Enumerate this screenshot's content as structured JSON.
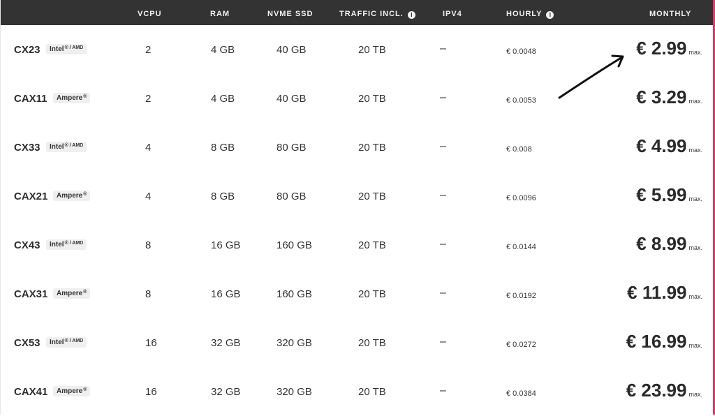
{
  "header": {
    "columns": [
      "VCPU",
      "RAM",
      "NVME SSD",
      "TRAFFIC INCL.",
      "IPV4",
      "HOURLY",
      "MONTHLY"
    ],
    "info_icon": "i"
  },
  "rows": [
    {
      "name": "CX23",
      "cpu": "Intel",
      "cpu_suffix": "® / AMD",
      "vcpu": "2",
      "ram": "4 GB",
      "ssd": "40 GB",
      "traffic": "20 TB",
      "ipv4": "–",
      "hourly": "€ 0.0048",
      "monthly": "€ 2.99",
      "max": "max."
    },
    {
      "name": "CAX11",
      "cpu": "Ampere",
      "cpu_suffix": "®",
      "vcpu": "2",
      "ram": "4 GB",
      "ssd": "40 GB",
      "traffic": "20 TB",
      "ipv4": "–",
      "hourly": "€ 0.0053",
      "monthly": "€ 3.29",
      "max": "max."
    },
    {
      "name": "CX33",
      "cpu": "Intel",
      "cpu_suffix": "® / AMD",
      "vcpu": "4",
      "ram": "8 GB",
      "ssd": "80 GB",
      "traffic": "20 TB",
      "ipv4": "–",
      "hourly": "€ 0.008",
      "monthly": "€ 4.99",
      "max": "max."
    },
    {
      "name": "CAX21",
      "cpu": "Ampere",
      "cpu_suffix": "®",
      "vcpu": "4",
      "ram": "8 GB",
      "ssd": "80 GB",
      "traffic": "20 TB",
      "ipv4": "–",
      "hourly": "€ 0.0096",
      "monthly": "€ 5.99",
      "max": "max."
    },
    {
      "name": "CX43",
      "cpu": "Intel",
      "cpu_suffix": "® / AMD",
      "vcpu": "8",
      "ram": "16 GB",
      "ssd": "160 GB",
      "traffic": "20 TB",
      "ipv4": "–",
      "hourly": "€ 0.0144",
      "monthly": "€ 8.99",
      "max": "max."
    },
    {
      "name": "CAX31",
      "cpu": "Ampere",
      "cpu_suffix": "®",
      "vcpu": "8",
      "ram": "16 GB",
      "ssd": "160 GB",
      "traffic": "20 TB",
      "ipv4": "–",
      "hourly": "€ 0.0192",
      "monthly": "€ 11.99",
      "max": "max."
    },
    {
      "name": "CX53",
      "cpu": "Intel",
      "cpu_suffix": "® / AMD",
      "vcpu": "16",
      "ram": "32 GB",
      "ssd": "320 GB",
      "traffic": "20 TB",
      "ipv4": "–",
      "hourly": "€ 0.0272",
      "monthly": "€ 16.99",
      "max": "max."
    },
    {
      "name": "CAX41",
      "cpu": "Ampere",
      "cpu_suffix": "®",
      "vcpu": "16",
      "ram": "32 GB",
      "ssd": "320 GB",
      "traffic": "20 TB",
      "ipv4": "–",
      "hourly": "€ 0.0384",
      "monthly": "€ 23.99",
      "max": "max."
    }
  ],
  "colors": {
    "header_bg": "#333333",
    "accent_edge": "#e8336d"
  },
  "annotation": {
    "icon": "arrow-icon"
  }
}
